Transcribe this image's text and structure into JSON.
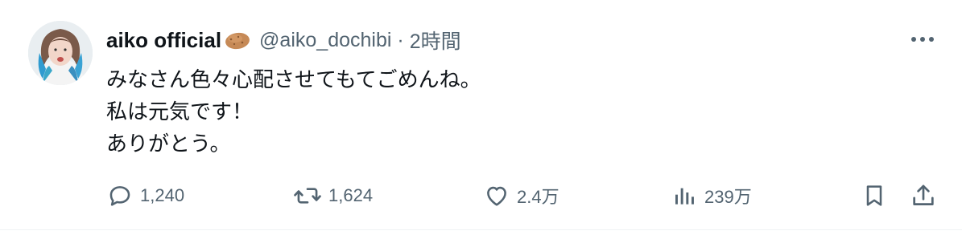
{
  "tweet": {
    "author": {
      "display_name": "aiko official",
      "name_emoji": "potato-emoji",
      "handle": "@aiko_dochibi",
      "separator": "·",
      "time": "2時間"
    },
    "body_lines": [
      "みなさん色々心配させてもてごめんね。",
      "私は元気です！",
      "ありがとう。"
    ],
    "actions": {
      "reply": {
        "icon": "reply-icon",
        "count": "1,240"
      },
      "retweet": {
        "icon": "retweet-icon",
        "count": "1,624"
      },
      "like": {
        "icon": "heart-icon",
        "count": "2.4万"
      },
      "views": {
        "icon": "views-icon",
        "count": "239万"
      },
      "bookmark": {
        "icon": "bookmark-icon"
      },
      "share": {
        "icon": "share-icon"
      }
    },
    "more_icon": "more-dots-icon"
  },
  "colors": {
    "text_primary": "#0f1419",
    "text_secondary": "#536471",
    "divider": "#eff3f4"
  }
}
